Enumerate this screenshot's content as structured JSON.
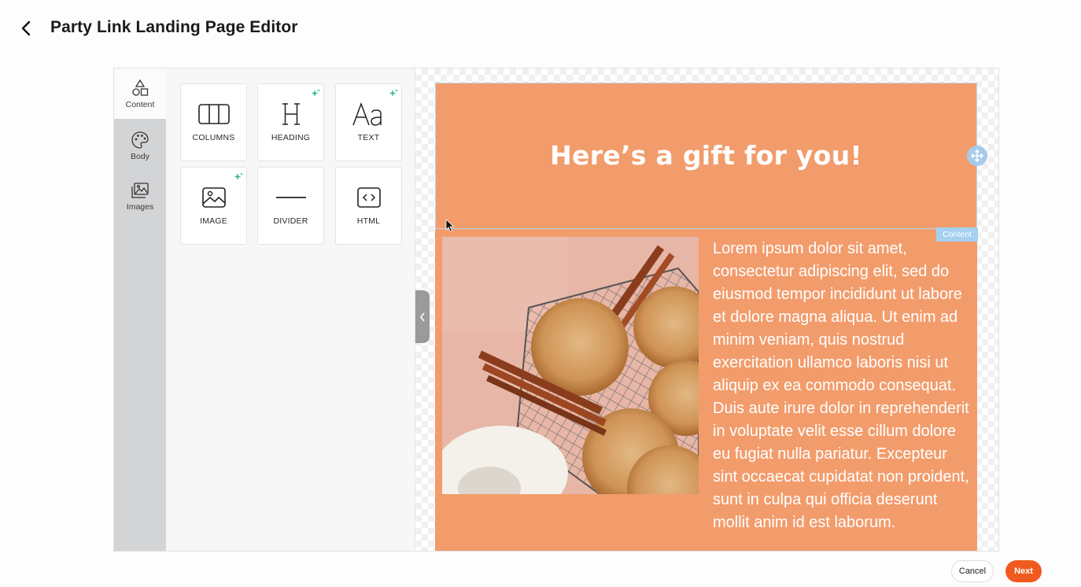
{
  "header": {
    "title": "Party Link Landing Page Editor"
  },
  "tabs": [
    {
      "label": "Content",
      "icon": "shapes-icon"
    },
    {
      "label": "Body",
      "icon": "palette-icon"
    },
    {
      "label": "Images",
      "icon": "images-icon"
    }
  ],
  "blocks": [
    {
      "label": "COLUMNS",
      "icon": "columns-icon",
      "ai": false
    },
    {
      "label": "HEADING",
      "icon": "heading-icon",
      "ai": true
    },
    {
      "label": "TEXT",
      "icon": "text-icon",
      "ai": true
    },
    {
      "label": "IMAGE",
      "icon": "image-icon",
      "ai": true
    },
    {
      "label": "DIVIDER",
      "icon": "divider-icon",
      "ai": false
    },
    {
      "label": "HTML",
      "icon": "html-icon",
      "ai": false
    }
  ],
  "page": {
    "hero_title": "Here’s a gift for you!",
    "content_tag": "Content",
    "body_text": "Lorem ipsum dolor sit amet, consectetur adipiscing elit, sed do eiusmod tempor incididunt ut labore et dolore magna aliqua. Ut enim ad minim veniam, quis nostrud exercitation ullamco laboris nisi ut aliquip ex ea commodo consequat. Duis aute irure dolor in reprehenderit in voluptate velit esse cillum dolore eu fugiat nulla pariatur. Excepteur sint occaecat cupidatat non proident, sunt in culpa qui officia deserunt mollit anim id est laborum.",
    "background_color": "#f29c6c"
  },
  "footer": {
    "cancel_label": "Cancel",
    "next_label": "Next"
  },
  "colors": {
    "accent": "#f05a1e",
    "selection": "#a5d0ef",
    "ai_sparkle": "#2bb596"
  }
}
